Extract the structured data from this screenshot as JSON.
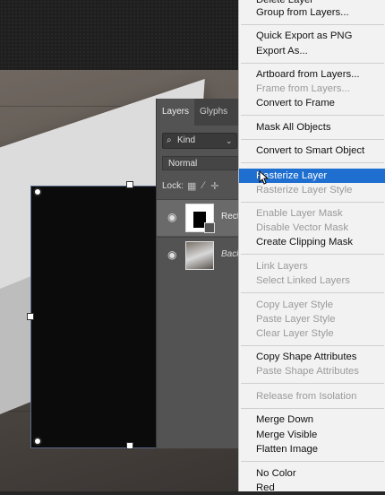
{
  "layers_panel": {
    "tabs": [
      "Layers",
      "Glyphs"
    ],
    "filter": {
      "icon": "search-icon",
      "label": "Kind",
      "chevron": "chevron-down-icon"
    },
    "blend_mode": "Normal",
    "lock_label": "Lock:",
    "lock_icons": [
      "checkerboard-icon",
      "brush-icon",
      "move-icon"
    ],
    "layers": [
      {
        "name": "Rect",
        "selected": true,
        "thumb": "shape"
      },
      {
        "name": "Back",
        "selected": false,
        "thumb": "photo"
      }
    ]
  },
  "menu": {
    "items": [
      {
        "label": "Delete Layer",
        "disabled": false
      },
      {
        "label": "Group from Layers...",
        "disabled": false
      },
      {
        "label": "Quick Export as PNG",
        "disabled": false
      },
      {
        "label": "Export As...",
        "disabled": false
      },
      {
        "label": "Artboard from Layers...",
        "disabled": false
      },
      {
        "label": "Frame from Layers...",
        "disabled": true
      },
      {
        "label": "Convert to Frame",
        "disabled": false
      },
      {
        "label": "Mask All Objects",
        "disabled": false
      },
      {
        "label": "Convert to Smart Object",
        "disabled": false
      },
      {
        "label": "Rasterize Layer",
        "disabled": false,
        "highlighted": true
      },
      {
        "label": "Rasterize Layer Style",
        "disabled": true
      },
      {
        "label": "Enable Layer Mask",
        "disabled": true
      },
      {
        "label": "Disable Vector Mask",
        "disabled": true
      },
      {
        "label": "Create Clipping Mask",
        "disabled": false
      },
      {
        "label": "Link Layers",
        "disabled": true
      },
      {
        "label": "Select Linked Layers",
        "disabled": true
      },
      {
        "label": "Copy Layer Style",
        "disabled": true
      },
      {
        "label": "Paste Layer Style",
        "disabled": true
      },
      {
        "label": "Clear Layer Style",
        "disabled": true
      },
      {
        "label": "Copy Shape Attributes",
        "disabled": false
      },
      {
        "label": "Paste Shape Attributes",
        "disabled": true
      },
      {
        "label": "Release from Isolation",
        "disabled": true
      },
      {
        "label": "Merge Down",
        "disabled": false
      },
      {
        "label": "Merge Visible",
        "disabled": false
      },
      {
        "label": "Flatten Image",
        "disabled": false
      },
      {
        "label": "No Color",
        "disabled": false
      },
      {
        "label": "Red",
        "disabled": false
      }
    ]
  },
  "colors": {
    "highlight": "#1f6fd1",
    "menu_bg": "#f2f2f2",
    "panel_bg": "#535353"
  }
}
